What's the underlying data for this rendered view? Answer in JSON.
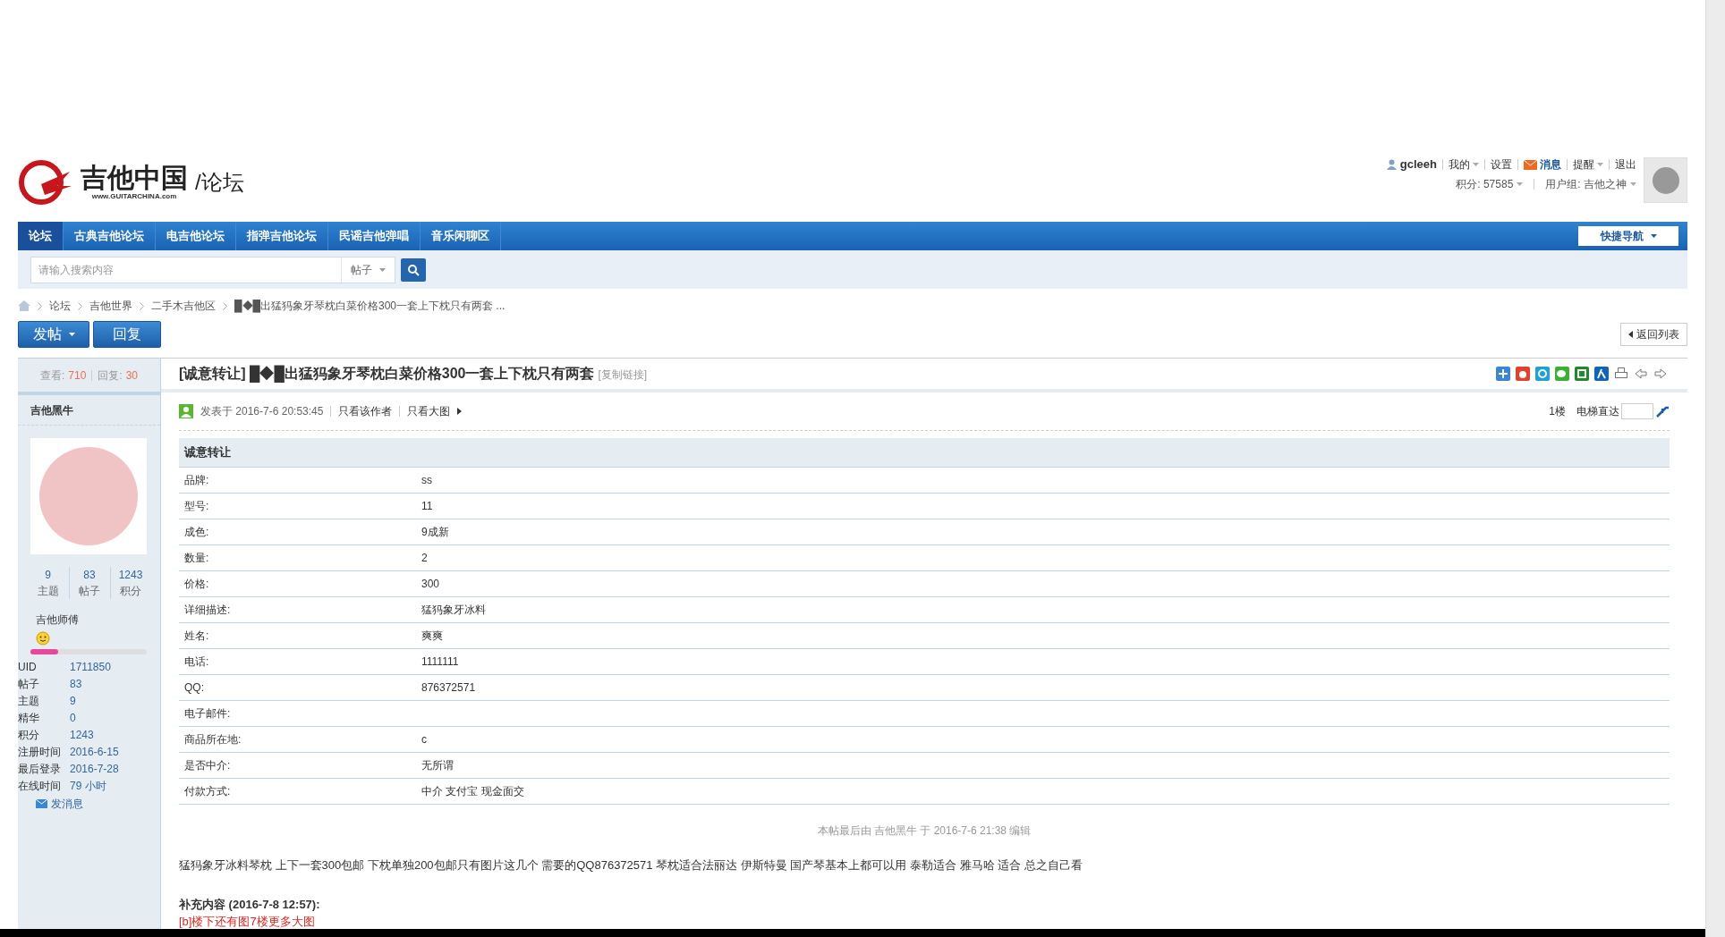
{
  "logo": {
    "name": "吉他中国",
    "url": "www.GUITARCHINA.com",
    "section": "/论坛"
  },
  "user_bar": {
    "username": "gcleeh",
    "links": [
      {
        "label": "我的",
        "kind": "menu"
      },
      {
        "label": "设置",
        "kind": "link"
      },
      {
        "label": "消息",
        "kind": "message"
      },
      {
        "label": "提醒",
        "kind": "menu"
      },
      {
        "label": "退出",
        "kind": "link"
      }
    ],
    "stats": [
      {
        "label": "积分: 57585",
        "kind": "menu"
      },
      {
        "label": "用户组: 吉他之神",
        "kind": "menu"
      }
    ]
  },
  "nav": [
    {
      "label": "论坛",
      "selected": true
    },
    {
      "label": "古典吉他论坛",
      "selected": false
    },
    {
      "label": "电吉他论坛",
      "selected": false
    },
    {
      "label": "指弹吉他论坛",
      "selected": false
    },
    {
      "label": "民谣吉他弹唱",
      "selected": false
    },
    {
      "label": "音乐闲聊区",
      "selected": false
    }
  ],
  "quick_nav": "快捷导航",
  "search": {
    "placeholder": "请输入搜索内容",
    "scope": "帖子"
  },
  "breadcrumb": [
    "论坛",
    "吉他世界",
    "二手木吉他区",
    "█◆█出猛犸象牙琴枕白菜价格300一套上下枕只有两套 ..."
  ],
  "actions": {
    "post": "发帖",
    "reply": "回复",
    "back": "返回列表"
  },
  "thread": {
    "views_label": "查看:",
    "views": "710",
    "replies_label": "回复:",
    "replies": "30",
    "title": "[诚意转让] █◆█出猛犸象牙琴枕白菜价格300一套上下枕只有两套",
    "copy_link": "[复制链接]"
  },
  "author": {
    "name": "吉他黑牛",
    "counts": [
      {
        "value": "9",
        "label": "主题"
      },
      {
        "value": "83",
        "label": "帖子"
      },
      {
        "value": "1243",
        "label": "积分"
      }
    ],
    "rank": "吉他师傅",
    "level": 0.24,
    "info": [
      {
        "label": "UID",
        "value": "1711850"
      },
      {
        "label": "帖子",
        "value": "83"
      },
      {
        "label": "主题",
        "value": "9"
      },
      {
        "label": "精华",
        "value": "0"
      },
      {
        "label": "积分",
        "value": "1243"
      },
      {
        "label": "注册时间",
        "value": "2016-6-15"
      },
      {
        "label": "最后登录",
        "value": "2016-7-28"
      },
      {
        "label": "在线时间",
        "value": "79 小时"
      }
    ],
    "message": "发消息"
  },
  "post": {
    "posted": "发表于 2016-7-6 20:53:45",
    "author_only": "只看该作者",
    "big_images": "只看大图",
    "floor": "1楼",
    "jump_label": "电梯直达",
    "table_title": "诚意转让",
    "fields": [
      {
        "label": "品牌:",
        "value": "ss"
      },
      {
        "label": "型号:",
        "value": "11"
      },
      {
        "label": "成色:",
        "value": "9成新"
      },
      {
        "label": "数量:",
        "value": "2"
      },
      {
        "label": "价格:",
        "value": "300"
      },
      {
        "label": "详细描述:",
        "value": "猛犸象牙冰料"
      },
      {
        "label": "姓名:",
        "value": "爽爽"
      },
      {
        "label": "电话:",
        "value": "1111111"
      },
      {
        "label": "QQ:",
        "value": "876372571"
      },
      {
        "label": "电子邮件:"
      },
      {
        "label": "商品所在地:",
        "value": "c"
      },
      {
        "label": "是否中介:",
        "value": "无所谓"
      },
      {
        "label": "付款方式:",
        "value": "中介 支付宝 现金面交"
      }
    ],
    "edit_note": "本帖最后由 吉他黑牛 于 2016-7-6 21:38 编辑",
    "body": "猛犸象牙冰料琴枕 上下一套300包邮 下枕单独200包邮只有图片这几个 需要的QQ876372571  琴枕适合法丽达  伊斯特曼  国产琴基本上都可以用  泰勒适合   雅马哈 适合  总之自己看",
    "supplement_title": "补充内容 (2016-7-8 12:57):",
    "supplement": "[b]楼下还有图7楼更多大图"
  }
}
